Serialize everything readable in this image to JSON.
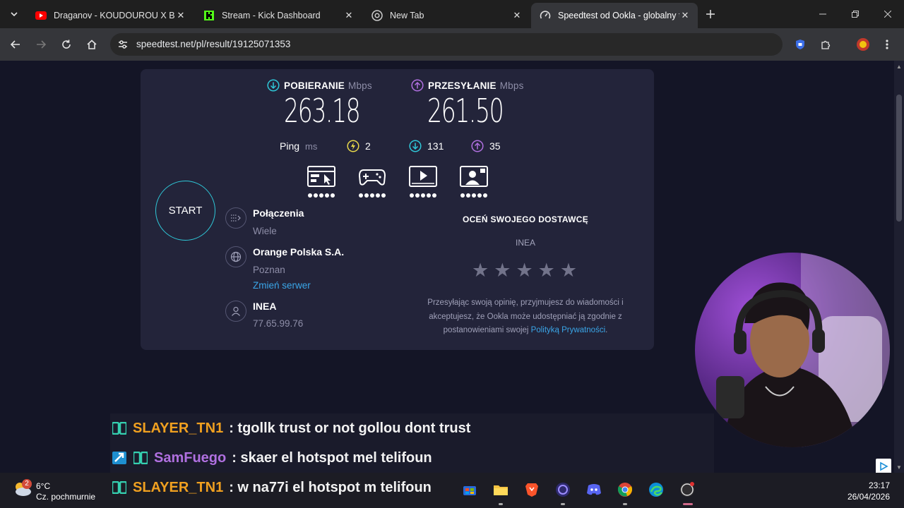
{
  "browser": {
    "tabs": [
      {
        "title": "Draganov - KOUDOUROU X BO",
        "icon": "youtube-icon",
        "active": false
      },
      {
        "title": "Stream - Kick Dashboard",
        "icon": "kick-icon",
        "active": false
      },
      {
        "title": "New Tab",
        "icon": "chrome-icon",
        "active": false
      },
      {
        "title": "Speedtest od Ookla - globalny t",
        "icon": "speedtest-icon",
        "active": true
      }
    ],
    "url": "speedtest.net/pl/result/19125071353"
  },
  "speedtest": {
    "download": {
      "label": "POBIERANIE",
      "unit": "Mbps",
      "value": "263.18"
    },
    "upload": {
      "label": "PRZESYŁANIE",
      "unit": "Mbps",
      "value": "261.50"
    },
    "ping": {
      "label": "Ping",
      "unit": "ms",
      "idle": "2",
      "download": "131",
      "upload": "35"
    },
    "start_label": "START",
    "connections": {
      "title": "Połączenia",
      "value": "Wiele"
    },
    "server": {
      "title": "Orange Polska S.A.",
      "location": "Poznan",
      "change_link": "Zmień serwer"
    },
    "isp": {
      "title": "INEA",
      "ip": "77.65.99.76"
    },
    "rating": {
      "title": "OCEŃ SWOJEGO DOSTAWCĘ",
      "isp": "INEA",
      "stars": 5,
      "consent_text": "Przesyłając swoją opinię, przyjmujesz do wiadomości i akceptujesz, że Ookla może udostępniać ją zgodnie z postanowieniami swojej ",
      "consent_link": "Polityką Prywatności",
      "consent_end": "."
    }
  },
  "chat": [
    {
      "user": "SLAYER_TN1",
      "color": "#f0a020",
      "message": ": tgollk trust or not gollou dont trust"
    },
    {
      "user": "SamFuego",
      "color": "#b070e0",
      "message": ": skaer el hotspot mel telifoun"
    },
    {
      "user": "SLAYER_TN1",
      "color": "#f0a020",
      "message": ": w na77i el hotspot m telifoun"
    }
  ],
  "taskbar": {
    "weather_temp": "6°C",
    "weather_desc": "Cz. pochmurnie",
    "weather_badge": "2",
    "time": "23:17",
    "date": "26/04/2026"
  },
  "colors": {
    "accent_cyan": "#2fc8d8",
    "download": "#2fc8d8",
    "upload": "#b070e0",
    "link": "#3aa6e8"
  }
}
